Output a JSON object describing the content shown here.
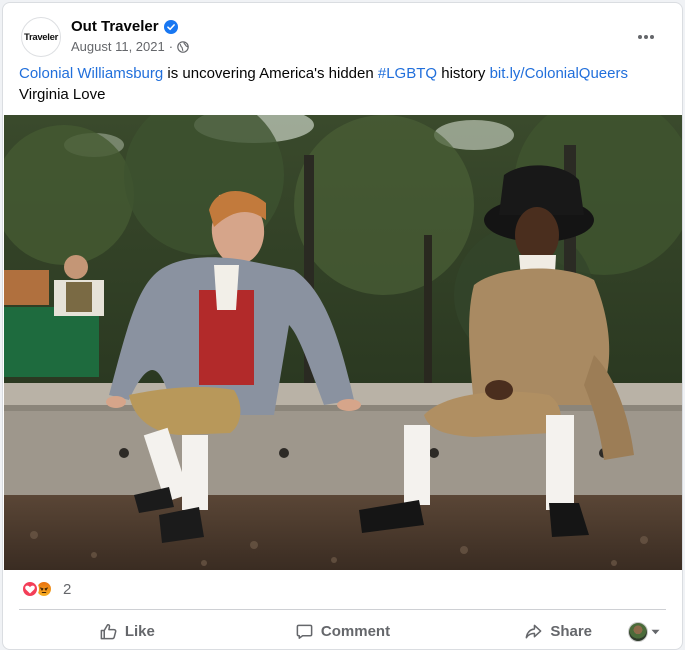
{
  "post": {
    "page_name": "Out Traveler",
    "avatar_text": "Traveler",
    "date": "August 11, 2021",
    "separator": "·",
    "caption": {
      "link1": "Colonial Williamsburg",
      "text1": " is uncovering America's hidden ",
      "hashtag": "#LGBTQ",
      "text2": " history ",
      "link2": "bit.ly/ColonialQueers",
      "line2": "Virginia Love"
    },
    "photo_icon": "photo-of-two-actors-in-colonial-costume"
  },
  "reactions": {
    "icons": [
      "love-icon",
      "angry-icon"
    ],
    "count": "2"
  },
  "actions": {
    "like": "Like",
    "comment": "Comment",
    "share": "Share"
  },
  "colors": {
    "link": "#216fdb",
    "verified": "#1877f2",
    "secondary_text": "#65676b"
  }
}
